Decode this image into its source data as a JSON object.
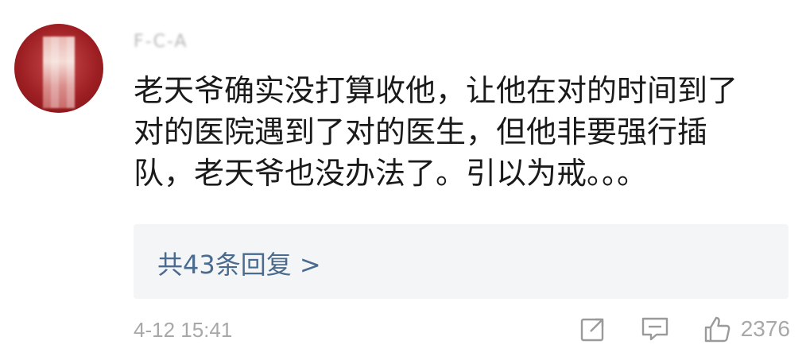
{
  "comment": {
    "username": "F-C-A",
    "lines": [
      "老天爷确实没打算收他，让他在对的时间到了",
      "对的医院遇到了对的医生，但他非要强行插",
      "队，老天爷也没办法了。引以为戒。。。"
    ],
    "reply_link": "共43条回复 >",
    "timestamp": "4-12 15:41",
    "like_count": "2376"
  },
  "icons": {
    "share": "share-icon",
    "comment": "comment-icon",
    "like": "thumbs-up-icon"
  },
  "colors": {
    "text": "#1a1a1a",
    "meta": "#a8a8a8",
    "reply_link": "#4a6a8e",
    "reply_bg": "#f4f5f7"
  }
}
